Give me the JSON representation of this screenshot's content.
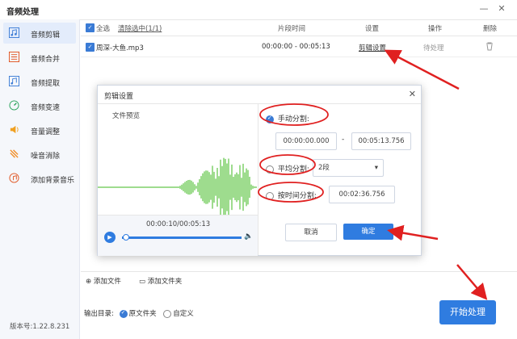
{
  "window": {
    "title": "音频处理",
    "minimize": "—",
    "close": "✕"
  },
  "sidebar": {
    "items": [
      {
        "label": "音频剪辑",
        "icon": "music-note-icon",
        "active": true
      },
      {
        "label": "音频合并",
        "icon": "merge-icon"
      },
      {
        "label": "音频提取",
        "icon": "extract-music-icon"
      },
      {
        "label": "音频变速",
        "icon": "speed-icon"
      },
      {
        "label": "音量调整",
        "icon": "volume-icon"
      },
      {
        "label": "噪音消除",
        "icon": "noise-cancel-icon"
      },
      {
        "label": "添加背景音乐",
        "icon": "background-music-icon"
      }
    ],
    "version": "版本号:1.22.8.231"
  },
  "list": {
    "header": {
      "select_all": "全选",
      "clear_selected": "清除选中(1/1)",
      "segment_time": "片段时间",
      "settings": "设置",
      "action": "操作",
      "delete": "删除"
    },
    "rows": [
      {
        "name": "周深-大鱼.mp3",
        "time": "00:00:00 - 00:05:13",
        "settings_link": "剪辑设置",
        "status": "待处理"
      }
    ]
  },
  "bottom": {
    "add_file": "添加文件",
    "add_folder": "添加文件夹",
    "output_label": "输出目录:",
    "output_original": "原文件夹",
    "output_custom": "自定义",
    "start": "开始处理"
  },
  "dialog": {
    "title": "剪辑设置",
    "close": "✕",
    "preview_title": "文件预览",
    "time_display": "00:00:10/00:05:13",
    "playback_fraction": 0.03,
    "manual_split": "手动分割:",
    "manual_start": "00:00:00.000",
    "range_sep": "-",
    "manual_end": "00:05:13.756",
    "average_split": "平均分割:",
    "average_value": "2段",
    "time_split": "按时间分割:",
    "time_value": "00:02:36.756",
    "cancel": "取消",
    "confirm": "确定"
  },
  "colors": {
    "accent": "#2f7ce0",
    "annotation_red": "#e02020",
    "wave_green": "#3cb81e"
  }
}
